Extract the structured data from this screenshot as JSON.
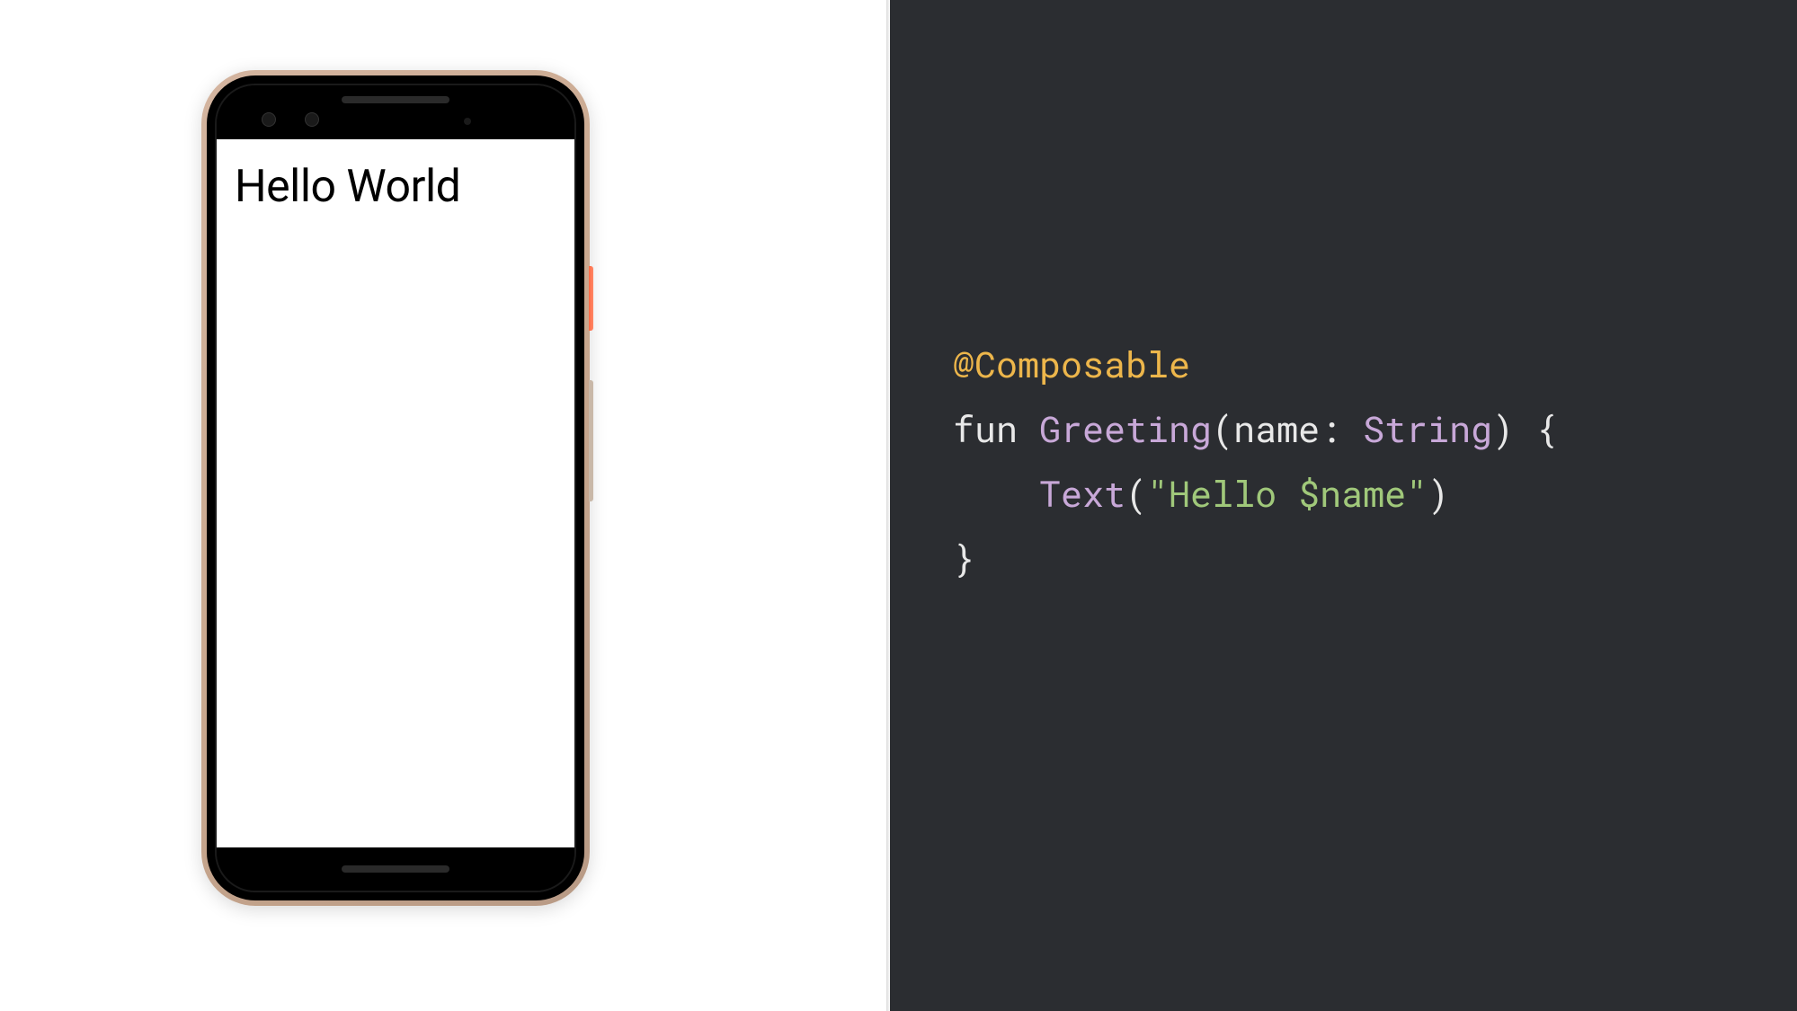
{
  "preview": {
    "screen_text": "Hello World"
  },
  "code": {
    "annotation": "@Composable",
    "keyword_fun": "fun",
    "function_name": "Greeting",
    "param_name": "name",
    "colon": ":",
    "param_type": "String",
    "open_paren": "(",
    "close_paren": ")",
    "open_brace": "{",
    "text_call": "Text",
    "string_literal": "\"Hello $name\"",
    "close_brace": "}"
  }
}
